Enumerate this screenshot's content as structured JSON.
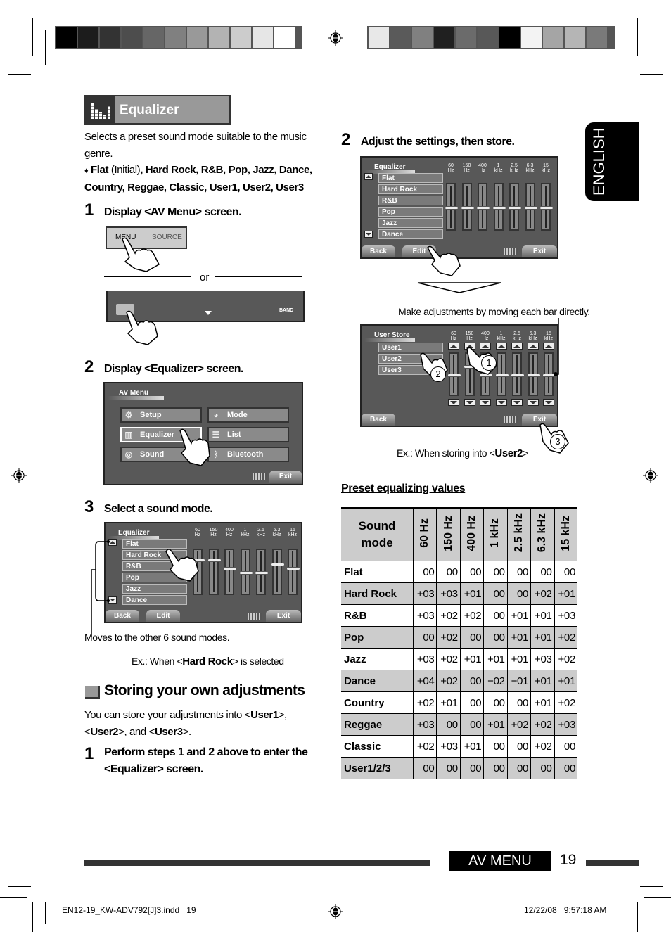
{
  "print_marks": {
    "color_bar_left": [
      "#000000",
      "#1c1c1c",
      "#333333",
      "#4d4d4d",
      "#666666",
      "#808080",
      "#999999",
      "#b3b3b3",
      "#cccccc",
      "#e6e6e6",
      "#ffffff"
    ],
    "color_bar_right": [
      "#e8e8e8",
      "#5a5a5a",
      "#808080",
      "#202020",
      "#6b6b6b",
      "#585858",
      "#000000",
      "#f3f3f3",
      "#a5a5a5",
      "#b5b5b5",
      "#7a7a7a"
    ]
  },
  "side_tab": {
    "label": "ENGLISH"
  },
  "section": {
    "title": "Equalizer",
    "icon": "equalizer-icon",
    "description": "Selects a preset sound mode suitable to the music genre.",
    "modes_intro_bullet": "♦",
    "modes_first": "Flat",
    "modes_initial": " (Initial)",
    "modes_rest": ", Hard Rock, R&B, Pop, Jazz, Dance, Country, Reggae, Classic, User1, User2, User3"
  },
  "steps_left": [
    {
      "num": "1",
      "text": "Display <AV Menu> screen."
    },
    {
      "num": "2",
      "text": "Display <Equalizer> screen."
    },
    {
      "num": "3",
      "text": "Select a sound mode."
    }
  ],
  "panel_buttons": {
    "menu": "MENU",
    "source": "SOURCE",
    "or": "or",
    "band": "BAND"
  },
  "av_menu_screen": {
    "title": "AV Menu",
    "items": [
      {
        "label": "Setup",
        "icon": "gear-icon"
      },
      {
        "label": "Mode",
        "icon": "mode-icon"
      },
      {
        "label": "Equalizer",
        "icon": "equalizer-icon"
      },
      {
        "label": "List",
        "icon": "list-icon"
      },
      {
        "label": "Sound",
        "icon": "speaker-icon"
      },
      {
        "label": "Bluetooth",
        "icon": "bluetooth-icon"
      }
    ],
    "exit": "Exit"
  },
  "eq_screen": {
    "title": "Equalizer",
    "freqs": [
      [
        "60",
        "Hz"
      ],
      [
        "150",
        "Hz"
      ],
      [
        "400",
        "Hz"
      ],
      [
        "1",
        "kHz"
      ],
      [
        "2.5",
        "kHz"
      ],
      [
        "6.3",
        "kHz"
      ],
      [
        "15",
        "kHz"
      ]
    ],
    "list": [
      "Flat",
      "Hard Rock",
      "R&B",
      "Pop",
      "Jazz",
      "Dance"
    ],
    "back": "Back",
    "edit": "Edit",
    "exit": "Exit"
  },
  "step3_notes": {
    "moves": "Moves to the other 6 sound modes.",
    "example_pre": "Ex.: When <",
    "example_bold": "Hard Rock",
    "example_post": "> is selected"
  },
  "storing": {
    "title": "Storing your own adjustments",
    "body_1": "You can store your adjustments into <",
    "u1": "User1",
    "body_2": ">,",
    "body_3": "<",
    "u2": "User2",
    "body_4": ">, and <",
    "u3": "User3",
    "body_5": ">.",
    "step1_num": "1",
    "step1_text": "Perform steps 1 and 2 above to enter the <Equalizer> screen."
  },
  "step2_right": {
    "num": "2",
    "text": "Adjust the settings, then store."
  },
  "make_adjustments": "Make adjustments by moving each bar directly.",
  "user_store_screen": {
    "title": "User Store",
    "list": [
      "User1",
      "User2",
      "User3"
    ],
    "back": "Back",
    "exit": "Exit",
    "callouts": [
      "1",
      "2",
      "3"
    ]
  },
  "user_store_note": {
    "pre": "Ex.: When storing into <",
    "bold": "User2",
    "post": ">"
  },
  "preset_table": {
    "title": "Preset equalizing values",
    "header_mode": "Sound mode",
    "header_freqs": [
      "60 Hz",
      "150 Hz",
      "400 Hz",
      "1 kHz",
      "2.5 kHz",
      "6.3 kHz",
      "15 kHz"
    ],
    "rows": [
      {
        "mode": "Flat",
        "values": [
          "00",
          "00",
          "00",
          "00",
          "00",
          "00",
          "00"
        ]
      },
      {
        "mode": "Hard Rock",
        "values": [
          "+03",
          "+03",
          "+01",
          "00",
          "00",
          "+02",
          "+01"
        ]
      },
      {
        "mode": "R&B",
        "values": [
          "+03",
          "+02",
          "+02",
          "00",
          "+01",
          "+01",
          "+03"
        ]
      },
      {
        "mode": "Pop",
        "values": [
          "00",
          "+02",
          "00",
          "00",
          "+01",
          "+01",
          "+02"
        ]
      },
      {
        "mode": "Jazz",
        "values": [
          "+03",
          "+02",
          "+01",
          "+01",
          "+01",
          "+03",
          "+02"
        ]
      },
      {
        "mode": "Dance",
        "values": [
          "+04",
          "+02",
          "00",
          "−02",
          "−01",
          "+01",
          "+01"
        ]
      },
      {
        "mode": "Country",
        "values": [
          "+02",
          "+01",
          "00",
          "00",
          "00",
          "+01",
          "+02"
        ]
      },
      {
        "mode": "Reggae",
        "values": [
          "+03",
          "00",
          "00",
          "+01",
          "+02",
          "+02",
          "+03"
        ]
      },
      {
        "mode": "Classic",
        "values": [
          "+02",
          "+03",
          "+01",
          "00",
          "00",
          "+02",
          "00"
        ]
      },
      {
        "mode": "User1/2/3",
        "values": [
          "00",
          "00",
          "00",
          "00",
          "00",
          "00",
          "00"
        ]
      }
    ]
  },
  "footer": {
    "section_label": "AV MENU",
    "page_number": "19",
    "file_info": "EN12-19_KW-ADV792[J]3.indd   19",
    "timestamp": "12/22/08   9:57:18 AM"
  }
}
